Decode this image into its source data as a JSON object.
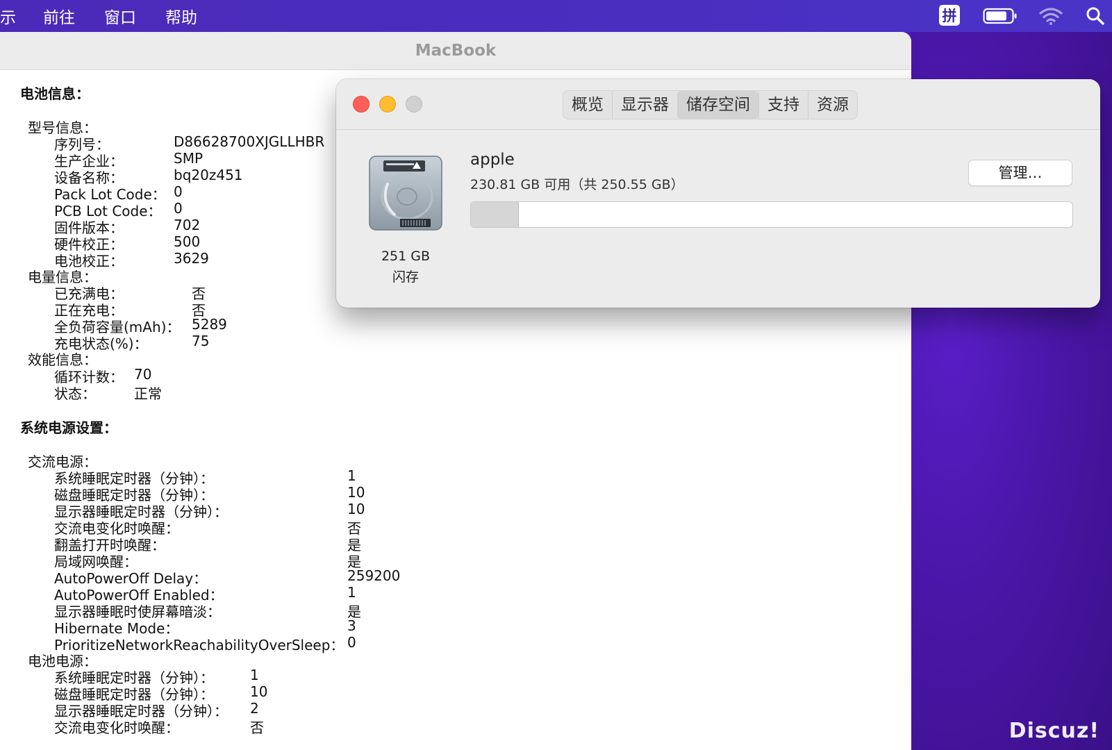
{
  "menubar": {
    "items": [
      "示",
      "前往",
      "窗口",
      "帮助"
    ],
    "ime_label": "拼"
  },
  "main_window": {
    "title": "MacBook",
    "battery_info": {
      "heading": "电池信息：",
      "model_heading": "型号信息：",
      "model": [
        {
          "label": "序列号：",
          "value": "D86628700XJGLLHBR"
        },
        {
          "label": "生产企业：",
          "value": "SMP"
        },
        {
          "label": "设备名称：",
          "value": "bq20z451"
        },
        {
          "label": "Pack Lot Code：",
          "value": "0"
        },
        {
          "label": "PCB Lot Code：",
          "value": "0"
        },
        {
          "label": "固件版本：",
          "value": "702"
        },
        {
          "label": "硬件校正：",
          "value": "500"
        },
        {
          "label": "电池校正：",
          "value": "3629"
        }
      ],
      "charge_heading": "电量信息：",
      "charge": [
        {
          "label": "已充满电：",
          "value": "否"
        },
        {
          "label": "正在充电：",
          "value": "否"
        },
        {
          "label": "全负荷容量(mAh)：",
          "value": "5289"
        },
        {
          "label": "充电状态(%)：",
          "value": "75"
        }
      ],
      "health_heading": "效能信息：",
      "health": [
        {
          "label": "循环计数：",
          "value": "70"
        },
        {
          "label": "状态：",
          "value": "正常"
        }
      ]
    },
    "power_settings": {
      "heading": "系统电源设置：",
      "ac_heading": "交流电源：",
      "ac": [
        {
          "label": "系统睡眠定时器（分钟）：",
          "value": "1"
        },
        {
          "label": "磁盘睡眠定时器（分钟）：",
          "value": "10"
        },
        {
          "label": "显示器睡眠定时器（分钟）：",
          "value": "10"
        },
        {
          "label": "交流电变化时唤醒：",
          "value": "否"
        },
        {
          "label": "翻盖打开时唤醒：",
          "value": "是"
        },
        {
          "label": "局域网唤醒：",
          "value": "是"
        },
        {
          "label": "AutoPowerOff Delay：",
          "value": "259200"
        },
        {
          "label": "AutoPowerOff Enabled：",
          "value": "1"
        },
        {
          "label": "显示器睡眠时使屏幕暗淡：",
          "value": "是"
        },
        {
          "label": "Hibernate Mode：",
          "value": "3"
        },
        {
          "label": "PrioritizeNetworkReachabilityOverSleep：",
          "value": "0"
        }
      ],
      "battery_heading": "电池电源：",
      "battery": [
        {
          "label": "系统睡眠定时器（分钟）：",
          "value": "1"
        },
        {
          "label": "磁盘睡眠定时器（分钟）：",
          "value": "10"
        },
        {
          "label": "显示器睡眠定时器（分钟）：",
          "value": "2"
        },
        {
          "label": "交流电变化时唤醒：",
          "value": "否"
        }
      ]
    }
  },
  "about_window": {
    "tabs": [
      "概览",
      "显示器",
      "储存空间",
      "支持",
      "资源"
    ],
    "active_tab": "储存空间",
    "disk_size": "251 GB",
    "disk_type": "闪存",
    "volume_name": "apple",
    "volume_free": "230.81 GB 可用（共 250.55 GB）",
    "manage_label": "管理…",
    "used_fraction": 0.079
  },
  "watermark": "Discuz!",
  "colors": {
    "close": "#ff5f57",
    "minimize": "#febc2e",
    "zoom_disabled": "#d0d0d0",
    "wallpaper": "#4a16a8"
  }
}
